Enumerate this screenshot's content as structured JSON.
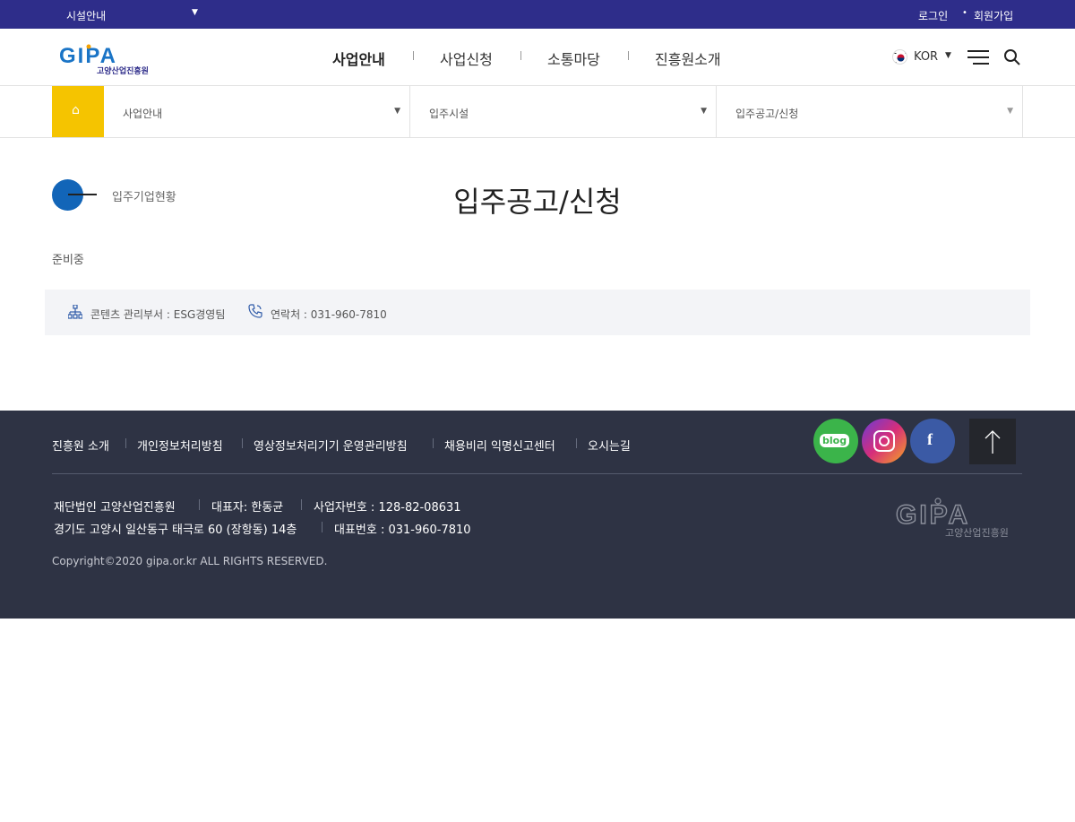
{
  "topbar": {
    "facility_label": "시설안내",
    "facility_arrow": "▼",
    "login": "로그인",
    "dot": "•",
    "join": "회원가입"
  },
  "header": {
    "logo_text": "GIPA",
    "logo_subtext": "고양산업진흥원",
    "gnb": [
      "사업안내",
      "사업신청",
      "소통마당",
      "진흥원소개"
    ],
    "lang": "KOR",
    "lang_arrow": "▼"
  },
  "locnav": {
    "home_icon": "⌂",
    "dropdowns": [
      "사업안내",
      "입주시설",
      "입주공고/신청"
    ],
    "arrow": "▼"
  },
  "content": {
    "back_label": "입주기업현황",
    "page_title": "입주공고/신청",
    "body_text": "준비중",
    "info": {
      "org": "콘텐츠 관리부서 : ESG경영팀",
      "phone": "연락처 : 031-960-7810"
    }
  },
  "footer": {
    "links": [
      "진흥원 소개",
      "개인정보처리방침",
      "영상정보처리기기 운영관리방침",
      "채용비리 익명신고센터",
      "오시는길"
    ],
    "sns": {
      "blog": "blog",
      "facebook": "f"
    },
    "info_line1": [
      "재단법인 고양산업진흥원",
      "대표자: 한동균",
      "사업자번호 : 128-82-08631"
    ],
    "info_line2": [
      "경기도 고양시 일산동구 태극로 60 (장항동) 14층",
      "대표번호 : 031-960-7810"
    ],
    "copyright": "Copyright©2020 gipa.or.kr ALL RIGHTS RESERVED.",
    "logo_text": "GIPA",
    "logo_subtext": "고양산업진흥원"
  },
  "colors": {
    "topbar": "#2e2d8a",
    "home": "#f5c400",
    "accent_blue": "#1265b8",
    "footer": "#2e3344"
  }
}
